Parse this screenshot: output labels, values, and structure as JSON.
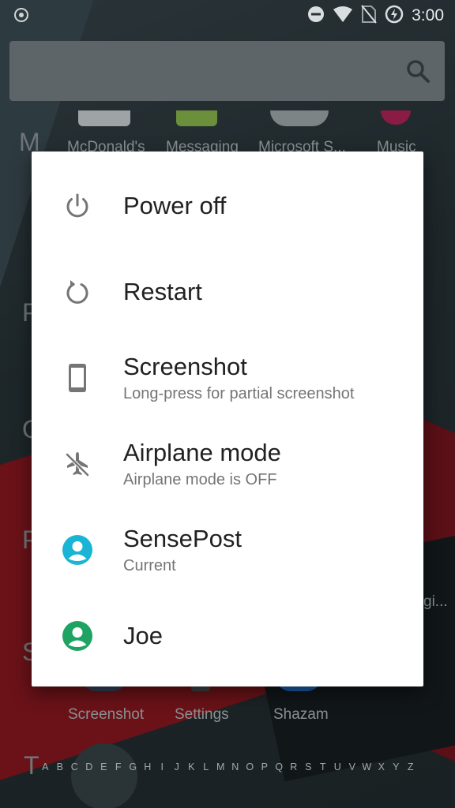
{
  "status_bar": {
    "time": "3:00"
  },
  "launcher": {
    "section_letters": [
      "M",
      "P",
      "O",
      "P",
      "S",
      "T"
    ],
    "top_apps": [
      "McDonald's",
      "Messaging",
      "Microsoft S...",
      "Music"
    ],
    "bottom_apps": [
      "Screenshot",
      "Settings",
      "Shazam"
    ],
    "partial_label": "gi...",
    "alphabet": [
      "A",
      "B",
      "C",
      "D",
      "E",
      "F",
      "G",
      "H",
      "I",
      "J",
      "K",
      "L",
      "M",
      "N",
      "O",
      "P",
      "Q",
      "R",
      "S",
      "T",
      "U",
      "V",
      "W",
      "X",
      "Y",
      "Z"
    ]
  },
  "power_menu": {
    "items": [
      {
        "title": "Power off",
        "subtitle": "",
        "icon": "power-icon"
      },
      {
        "title": "Restart",
        "subtitle": "",
        "icon": "restart-icon"
      },
      {
        "title": "Screenshot",
        "subtitle": "Long-press for partial screenshot",
        "icon": "phone-icon"
      },
      {
        "title": "Airplane mode",
        "subtitle": "Airplane mode is OFF",
        "icon": "airplane-off-icon"
      },
      {
        "title": "SensePost",
        "subtitle": "Current",
        "icon": "user-avatar-icon",
        "color": "#1ab4d4"
      },
      {
        "title": "Joe",
        "subtitle": "",
        "icon": "user-avatar-icon",
        "color": "#1ea362"
      }
    ]
  },
  "colors": {
    "dialog_bg": "#ffffff",
    "title_text": "#212121",
    "subtitle_text": "#757575",
    "icon_gray": "#757575",
    "sensepost_avatar": "#1ab4d4",
    "joe_avatar": "#1ea362"
  }
}
